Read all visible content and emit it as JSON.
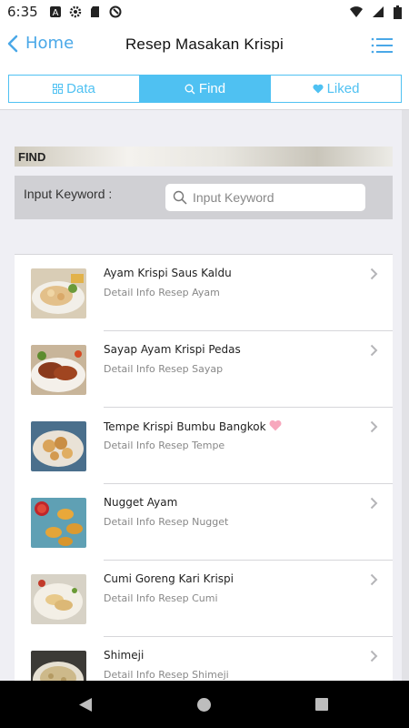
{
  "status_bar": {
    "time": "6:35"
  },
  "nav": {
    "back_label": "Home",
    "title": "Resep Masakan Krispi"
  },
  "tabs": [
    {
      "label": "Data",
      "icon": "grid-icon"
    },
    {
      "label": "Find",
      "icon": "search-icon"
    },
    {
      "label": "Liked",
      "icon": "heart-icon"
    }
  ],
  "find": {
    "header": "FIND",
    "label": "Input Keyword :",
    "placeholder": "Input Keyword"
  },
  "recipes": [
    {
      "title": "Ayam Krispi Saus Kaldu",
      "subtitle": "Detail Info Resep Ayam",
      "liked": false
    },
    {
      "title": "Sayap Ayam Krispi Pedas",
      "subtitle": "Detail Info Resep Sayap",
      "liked": false
    },
    {
      "title": "Tempe Krispi Bumbu Bangkok",
      "subtitle": "Detail Info Resep Tempe",
      "liked": true
    },
    {
      "title": "Nugget Ayam",
      "subtitle": "Detail Info Resep Nugget",
      "liked": false
    },
    {
      "title": "Cumi Goreng Kari Krispi",
      "subtitle": "Detail Info Resep Cumi",
      "liked": false
    },
    {
      "title": "Shimeji",
      "subtitle": "Detail Info Resep Shimeji",
      "liked": false
    }
  ],
  "colors": {
    "accent": "#4fc1f2",
    "back": "#4aa8e8",
    "heart": "#f7a8bd"
  }
}
